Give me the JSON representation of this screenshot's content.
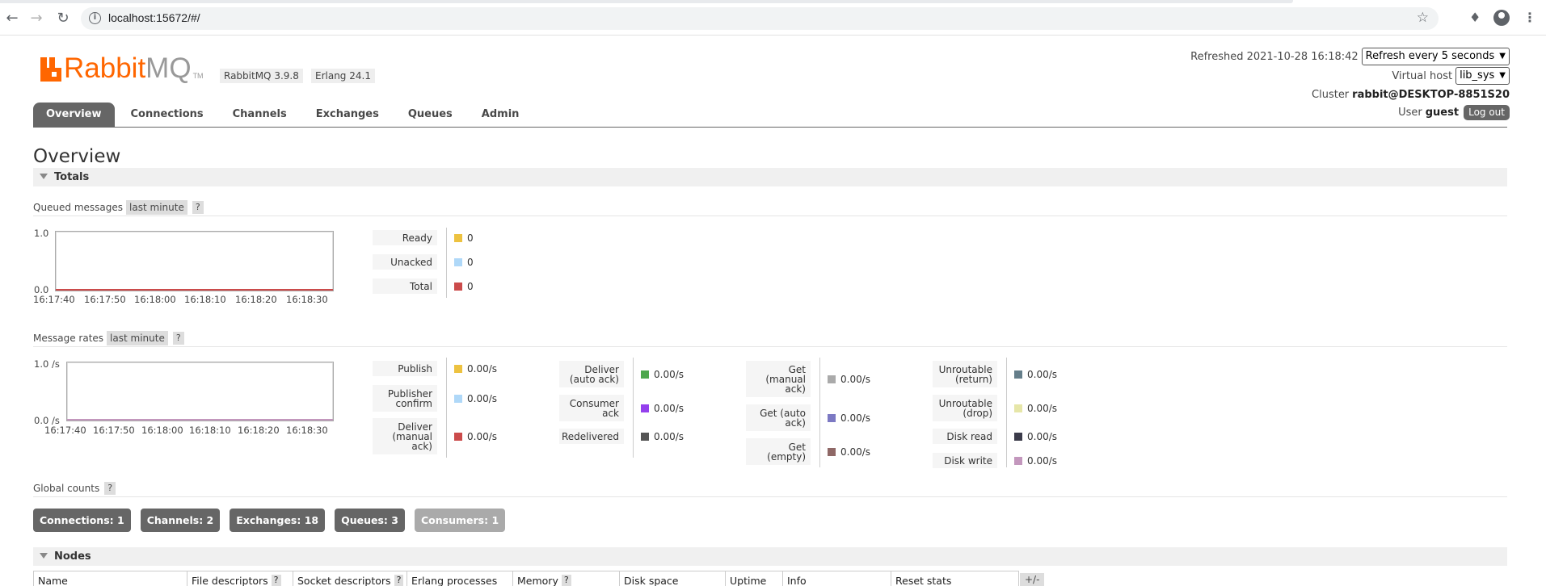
{
  "browser": {
    "url": "localhost:15672/#/",
    "back_icon": "arrow-left",
    "forward_icon": "arrow-right",
    "reload_icon": "reload",
    "info_icon": "info",
    "bookmark_icon": "star",
    "extensions_icon": "puzzle",
    "profile_icon": "account",
    "menu_icon": "kebab"
  },
  "header": {
    "logo_part1": "Rabbit",
    "logo_part2": "MQ",
    "logo_tm": "TM",
    "version": "RabbitMQ 3.9.8",
    "erlang": "Erlang 24.1",
    "refreshed_label": "Refreshed 2021-10-28 16:18:42",
    "refresh_select": "Refresh every 5 seconds",
    "vhost_label": "Virtual host",
    "vhost_select": "lib_sys",
    "cluster_label": "Cluster",
    "cluster_value": "rabbit@DESKTOP-8851S20",
    "user_label": "User",
    "user_value": "guest",
    "logout": "Log out"
  },
  "tabs": [
    {
      "label": "Overview",
      "active": true
    },
    {
      "label": "Connections"
    },
    {
      "label": "Channels"
    },
    {
      "label": "Exchanges"
    },
    {
      "label": "Queues"
    },
    {
      "label": "Admin"
    }
  ],
  "page_title": "Overview",
  "totals": {
    "section_title": "Totals",
    "queued": {
      "title": "Queued messages",
      "range": "last minute",
      "help": "?",
      "y_max": "1.0",
      "y_min": "0.0",
      "x_ticks": [
        "16:17:40",
        "16:17:50",
        "16:18:00",
        "16:18:10",
        "16:18:20",
        "16:18:30"
      ],
      "legend": [
        {
          "label": "Ready",
          "value": "0",
          "color": "#edc240"
        },
        {
          "label": "Unacked",
          "value": "0",
          "color": "#afd8f8"
        },
        {
          "label": "Total",
          "value": "0",
          "color": "#cb4b4b"
        }
      ]
    },
    "rates": {
      "title": "Message rates",
      "range": "last minute",
      "help": "?",
      "y_max": "1.0 /s",
      "y_min": "0.0 /s",
      "x_ticks": [
        "16:17:40",
        "16:17:50",
        "16:18:00",
        "16:18:10",
        "16:18:20",
        "16:18:30"
      ],
      "col1": [
        {
          "label": "Publish",
          "value": "0.00/s",
          "color": "#edc240"
        },
        {
          "label": "Publisher confirm",
          "value": "0.00/s",
          "color": "#afd8f8"
        },
        {
          "label": "Deliver (manual ack)",
          "value": "0.00/s",
          "color": "#cb4b4b"
        }
      ],
      "col2": [
        {
          "label": "Deliver (auto ack)",
          "value": "0.00/s",
          "color": "#4da74d"
        },
        {
          "label": "Consumer ack",
          "value": "0.00/s",
          "color": "#9440ed"
        },
        {
          "label": "Redelivered",
          "value": "0.00/s",
          "color": "#555555"
        }
      ],
      "col3": [
        {
          "label": "Get (manual ack)",
          "value": "0.00/s",
          "color": "#aaaaaa"
        },
        {
          "label": "Get (auto ack)",
          "value": "0.00/s",
          "color": "#7c79c3"
        },
        {
          "label": "Get (empty)",
          "value": "0.00/s",
          "color": "#8f6866"
        }
      ],
      "col4": [
        {
          "label": "Unroutable (return)",
          "value": "0.00/s",
          "color": "#657e8a"
        },
        {
          "label": "Unroutable (drop)",
          "value": "0.00/s",
          "color": "#e6e6a8"
        },
        {
          "label": "Disk read",
          "value": "0.00/s",
          "color": "#3b3b4a"
        },
        {
          "label": "Disk write",
          "value": "0.00/s",
          "color": "#c397bd"
        }
      ]
    },
    "global": {
      "title": "Global counts",
      "help": "?",
      "buttons": [
        {
          "label": "Connections: 1"
        },
        {
          "label": "Channels: 2"
        },
        {
          "label": "Exchanges: 18"
        },
        {
          "label": "Queues: 3"
        },
        {
          "label": "Consumers: 1"
        }
      ]
    }
  },
  "nodes": {
    "section_title": "Nodes",
    "columns": [
      {
        "label": "Name"
      },
      {
        "label": "File descriptors",
        "help": "?"
      },
      {
        "label": "Socket descriptors",
        "help": "?"
      },
      {
        "label": "Erlang processes"
      },
      {
        "label": "Memory",
        "help": "?"
      },
      {
        "label": "Disk space"
      },
      {
        "label": "Uptime"
      },
      {
        "label": "Info"
      },
      {
        "label": "Reset stats"
      }
    ],
    "toggle": "+/-"
  }
}
